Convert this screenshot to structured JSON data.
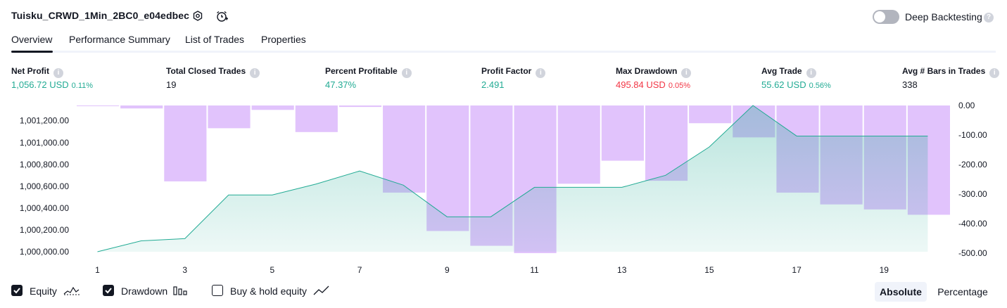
{
  "header": {
    "strategy_title": "Tuisku_CRWD_1Min_2BC0_e04edbec",
    "deep_backtesting_label": "Deep Backtesting",
    "deep_backtesting_enabled": false,
    "help_glyph": "?"
  },
  "tabs": [
    {
      "label": "Overview",
      "active": true
    },
    {
      "label": "Performance Summary",
      "active": false
    },
    {
      "label": "List of Trades",
      "active": false
    },
    {
      "label": "Properties",
      "active": false
    }
  ],
  "metrics": [
    {
      "label": "Net Profit",
      "value": "1,056.72 USD",
      "pct": "0.11%",
      "color": "#22ab94"
    },
    {
      "label": "Total Closed Trades",
      "value": "19",
      "pct": "",
      "color": "#131722"
    },
    {
      "label": "Percent Profitable",
      "value": "47.37%",
      "pct": "",
      "color": "#22ab94"
    },
    {
      "label": "Profit Factor",
      "value": "2.491",
      "pct": "",
      "color": "#22ab94"
    },
    {
      "label": "Max Drawdown",
      "value": "495.84 USD",
      "pct": "0.05%",
      "color": "#f23645"
    },
    {
      "label": "Avg Trade",
      "value": "55.62 USD",
      "pct": "0.56%",
      "color": "#22ab94"
    },
    {
      "label": "Avg # Bars in Trades",
      "value": "338",
      "pct": "",
      "color": "#131722"
    }
  ],
  "chart_data": {
    "type": "area",
    "x": [
      1,
      2,
      3,
      4,
      5,
      6,
      7,
      8,
      9,
      10,
      11,
      12,
      13,
      14,
      15,
      16,
      17,
      18,
      19,
      20
    ],
    "x_tick_labels": [
      "1",
      "3",
      "5",
      "7",
      "9",
      "11",
      "13",
      "15",
      "17",
      "19"
    ],
    "x_ticks": [
      1,
      3,
      5,
      7,
      9,
      11,
      13,
      15,
      17,
      19
    ],
    "y_left_tick_labels": [
      "1,001,200.00",
      "1,001,000.00",
      "1,000,800.00",
      "1,000,600.00",
      "1,000,400.00",
      "1,000,200.00",
      "1,000,000.00"
    ],
    "y_left_ticks": [
      1001200,
      1001000,
      1000800,
      1000600,
      1000400,
      1000200,
      1000000
    ],
    "y_left_range": [
      1000000,
      1001340
    ],
    "y_right_tick_labels": [
      "0.00",
      "-100.00",
      "-200.00",
      "-300.00",
      "-400.00",
      "-500.00"
    ],
    "y_right_ticks": [
      0,
      -100,
      -200,
      -300,
      -400,
      -500
    ],
    "y_right_range": [
      -500,
      0
    ],
    "series": [
      {
        "name": "Equity",
        "type": "area",
        "axis": "left",
        "color": "#22ab94",
        "values": [
          1000000,
          1000100,
          1000120,
          1000520,
          1000520,
          1000620,
          1000740,
          1000610,
          1000320,
          1000320,
          1000590,
          1000590,
          1000590,
          1000700,
          1000960,
          1001340,
          1001060,
          1001060,
          1001060,
          1001060
        ]
      },
      {
        "name": "Drawdown",
        "type": "bar",
        "axis": "right",
        "color": "#d4a9fb",
        "values": [
          -2,
          -10,
          -257,
          -77,
          -15,
          -90,
          -5,
          -295,
          -425,
          -475,
          -500,
          -265,
          -187,
          -255,
          -60,
          -108,
          -295,
          -335,
          -352,
          -370
        ]
      }
    ],
    "grid": false
  },
  "legend": {
    "equity_label": "Equity",
    "drawdown_label": "Drawdown",
    "buyhold_label": "Buy & hold equity",
    "equity_checked": true,
    "drawdown_checked": true,
    "buyhold_checked": false,
    "equity_icon": "equity-line-icon",
    "drawdown_icon": "drawdown-bars-icon",
    "buyhold_icon": "buyhold-line-icon"
  },
  "view_toggle": {
    "absolute_label": "Absolute",
    "percentage_label": "Percentage",
    "selected": "Absolute"
  }
}
